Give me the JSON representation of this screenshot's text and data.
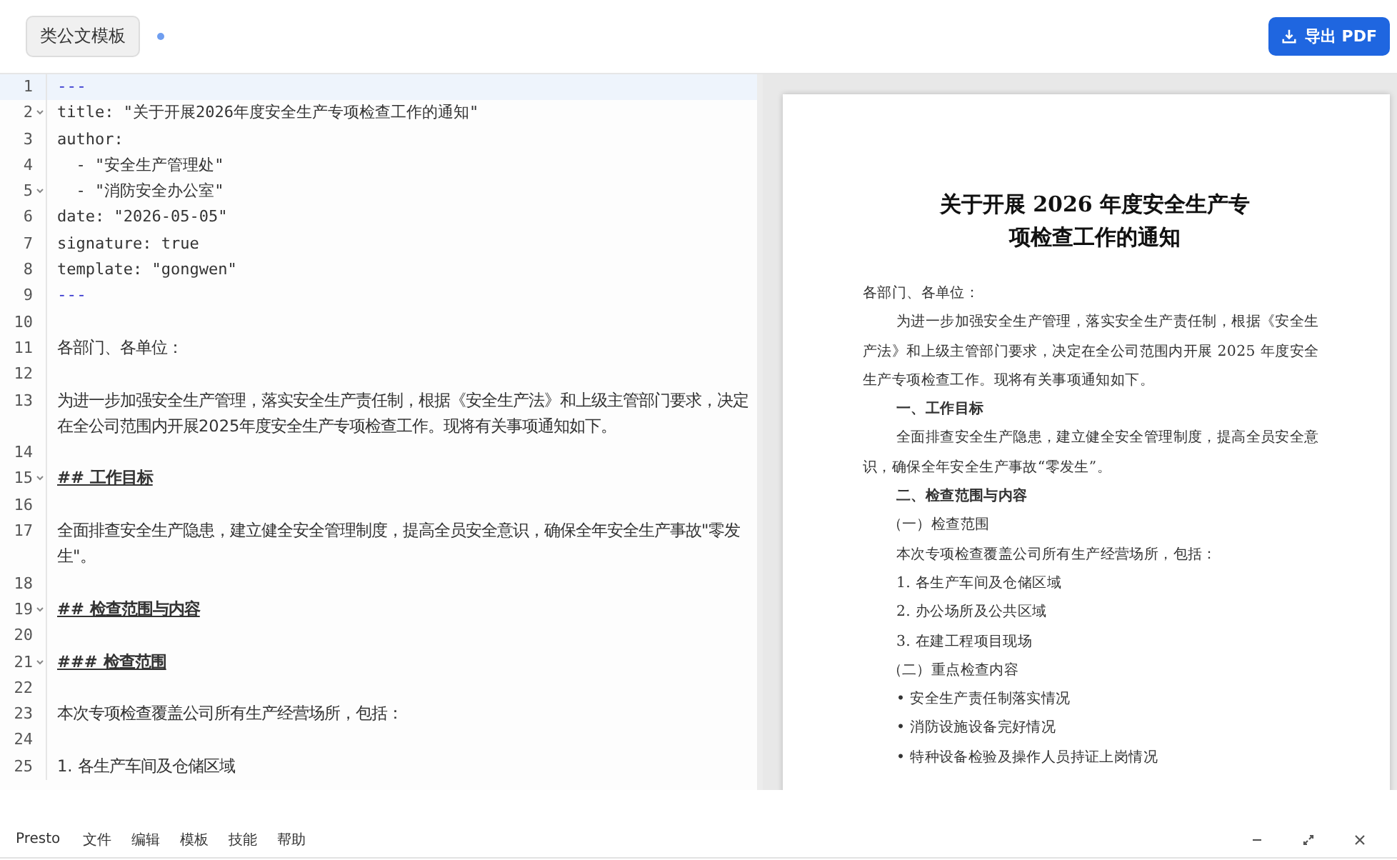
{
  "toolbar": {
    "template_button": "类公文模板",
    "unsaved": true,
    "export_button": "导出 PDF"
  },
  "editor": {
    "lines": [
      {
        "number": "1",
        "kind": "delimiter",
        "text": "---",
        "foldable": false,
        "active": true
      },
      {
        "number": "2",
        "kind": "code",
        "text": "title: \"关于开展2026年度安全生产专项检查工作的通知\"",
        "foldable": true,
        "active": false
      },
      {
        "number": "3",
        "kind": "code",
        "text": "author:",
        "foldable": false,
        "active": false
      },
      {
        "number": "4",
        "kind": "code",
        "text": "  - \"安全生产管理处\"",
        "foldable": false,
        "active": false
      },
      {
        "number": "5",
        "kind": "code",
        "text": "  - \"消防安全办公室\"",
        "foldable": true,
        "active": false
      },
      {
        "number": "6",
        "kind": "code",
        "text": "date: \"2026-05-05\"",
        "foldable": false,
        "active": false
      },
      {
        "number": "7",
        "kind": "code",
        "text": "signature: true",
        "foldable": false,
        "active": false
      },
      {
        "number": "8",
        "kind": "code",
        "text": "template: \"gongwen\"",
        "foldable": false,
        "active": false
      },
      {
        "number": "9",
        "kind": "delimiter",
        "text": "---",
        "foldable": false,
        "active": false
      },
      {
        "number": "10",
        "kind": "blank",
        "foldable": false,
        "active": false
      },
      {
        "number": "11",
        "kind": "text",
        "text": "各部门、各单位：",
        "foldable": false,
        "active": false
      },
      {
        "number": "12",
        "kind": "blank",
        "foldable": false,
        "active": false
      },
      {
        "number": "13",
        "kind": "text",
        "text": "为进一步加强安全生产管理，落实安全生产责任制，根据《安全生产法》和上级主管部门要求，决定在全公司范围内开展2025年度安全生产专项检查工作。现将有关事项通知如下。",
        "foldable": false,
        "active": false
      },
      {
        "number": "14",
        "kind": "blank",
        "foldable": false,
        "active": false
      },
      {
        "number": "15",
        "kind": "heading",
        "text": "## 工作目标",
        "foldable": true,
        "active": false
      },
      {
        "number": "16",
        "kind": "blank",
        "foldable": false,
        "active": false
      },
      {
        "number": "17",
        "kind": "text",
        "text": "全面排查安全生产隐患，建立健全安全管理制度，提高全员安全意识，确保全年安全生产事故\"零发生\"。",
        "foldable": false,
        "active": false
      },
      {
        "number": "18",
        "kind": "blank",
        "foldable": false,
        "active": false
      },
      {
        "number": "19",
        "kind": "heading",
        "text": "## 检查范围与内容",
        "foldable": true,
        "active": false
      },
      {
        "number": "20",
        "kind": "blank",
        "foldable": false,
        "active": false
      },
      {
        "number": "21",
        "kind": "heading",
        "text": "### 检查范围",
        "foldable": true,
        "active": false
      },
      {
        "number": "22",
        "kind": "blank",
        "foldable": false,
        "active": false
      },
      {
        "number": "23",
        "kind": "text",
        "text": "本次专项检查覆盖公司所有生产经营场所，包括：",
        "foldable": false,
        "active": false
      },
      {
        "number": "24",
        "kind": "blank",
        "foldable": false,
        "active": false
      },
      {
        "number": "25",
        "kind": "text",
        "text": "1. 各生产车间及仓储区域",
        "foldable": false,
        "active": false
      }
    ]
  },
  "preview": {
    "title_lines": [
      "关于开展 2026 年度安全生产专",
      "项检查工作的通知"
    ],
    "blocks": [
      {
        "kind": "salutation",
        "text": "各部门、各单位："
      },
      {
        "kind": "paragraph",
        "text": "为进一步加强安全生产管理，落实安全生产责任制，根据《安全生产法》和上级主管部门要求，决定在全公司范围内开展 2025 年度安全生产专项检查工作。现将有关事项通知如下。"
      },
      {
        "kind": "heading",
        "text": "一、工作目标"
      },
      {
        "kind": "paragraph",
        "text": "全面排查安全生产隐患，建立健全安全管理制度，提高全员安全意识，确保全年安全生产事故“零发生”。"
      },
      {
        "kind": "heading",
        "text": "二、检查范围与内容"
      },
      {
        "kind": "subheading",
        "text": "（一）检查范围"
      },
      {
        "kind": "item",
        "text": "本次专项检查覆盖公司所有生产经营场所，包括："
      },
      {
        "kind": "item",
        "text": "1. 各生产车间及仓储区域"
      },
      {
        "kind": "item",
        "text": "2. 办公场所及公共区域"
      },
      {
        "kind": "item",
        "text": "3. 在建工程项目现场"
      },
      {
        "kind": "subheading",
        "text": "（二）重点检查内容"
      },
      {
        "kind": "item",
        "text": "• 安全生产责任制落实情况"
      },
      {
        "kind": "item",
        "text": "• 消防设施设备完好情况"
      },
      {
        "kind": "item",
        "text": "• 特种设备检验及操作人员持证上岗情况"
      }
    ]
  },
  "menu_bar": {
    "app_name": "Presto",
    "menus": [
      "文件",
      "编辑",
      "模板",
      "技能",
      "帮助"
    ],
    "controls": [
      {
        "kind": "minimize"
      },
      {
        "kind": "maximize"
      },
      {
        "kind": "close"
      }
    ]
  }
}
